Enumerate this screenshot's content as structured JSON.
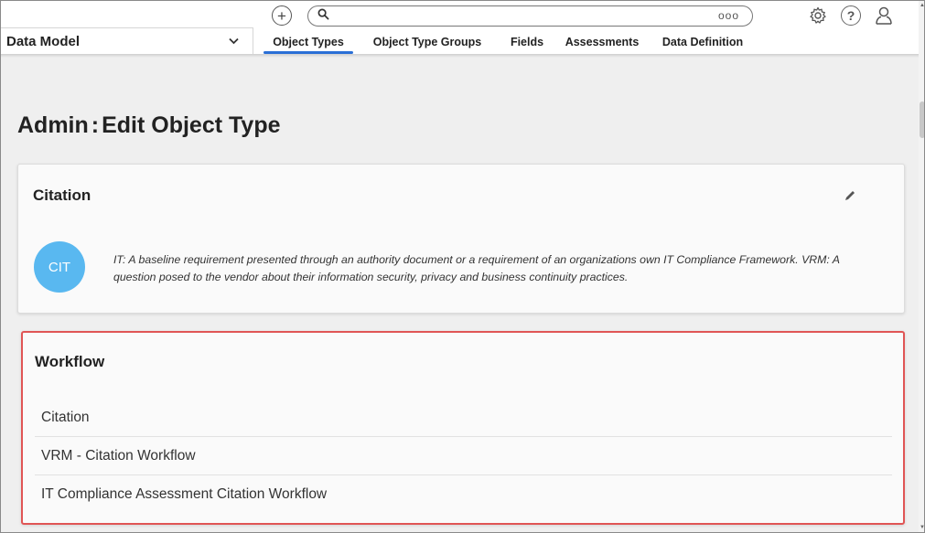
{
  "topbar": {
    "search_dots": "ooo",
    "help_glyph": "?"
  },
  "module_select": {
    "value": "Data Model"
  },
  "tabs": [
    {
      "label": "Object Types",
      "active": true
    },
    {
      "label": "Object Type Groups",
      "active": false
    },
    {
      "label": "Fields",
      "active": false
    },
    {
      "label": "Assessments",
      "active": false
    },
    {
      "label": "Data Definition",
      "active": false
    }
  ],
  "page": {
    "title_prefix": "Admin",
    "title_colon": ":",
    "title_suffix": "Edit Object Type"
  },
  "citation_card": {
    "title": "Citation",
    "avatar_text": "CIT",
    "avatar_color": "#59b8f0",
    "description": "IT: A baseline requirement presented through an authority document or a requirement of an organizations own IT Compliance Framework. VRM: A question posed to the vendor about their information security, privacy and business continuity practices."
  },
  "workflow_card": {
    "title": "Workflow",
    "highlight_color": "#e05555",
    "items": [
      "Citation",
      "VRM - Citation Workflow",
      "IT Compliance Assessment Citation Workflow"
    ]
  },
  "colors": {
    "accent": "#2a6fd6"
  }
}
